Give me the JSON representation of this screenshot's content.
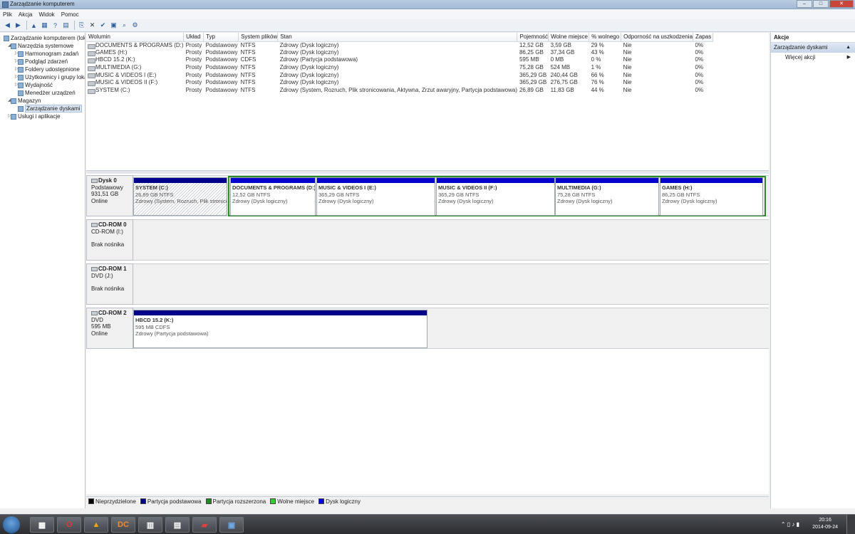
{
  "window": {
    "title": "Zarządzanie komputerem"
  },
  "menu": [
    "Plik",
    "Akcja",
    "Widok",
    "Pomoc"
  ],
  "tree": [
    {
      "label": "Zarządzanie komputerem (lokalne)",
      "level": 0,
      "twisty": ""
    },
    {
      "label": "Narzędzia systemowe",
      "level": 1,
      "twisty": "◢"
    },
    {
      "label": "Harmonogram zadań",
      "level": 2,
      "twisty": "▷"
    },
    {
      "label": "Podgląd zdarzeń",
      "level": 2,
      "twisty": "▷"
    },
    {
      "label": "Foldery udostępnione",
      "level": 2,
      "twisty": "▷"
    },
    {
      "label": "Użytkownicy i grupy lokalne",
      "level": 2,
      "twisty": "▷"
    },
    {
      "label": "Wydajność",
      "level": 2,
      "twisty": "▷"
    },
    {
      "label": "Menedżer urządzeń",
      "level": 2,
      "twisty": ""
    },
    {
      "label": "Magazyn",
      "level": 1,
      "twisty": "◢"
    },
    {
      "label": "Zarządzanie dyskami",
      "level": 2,
      "twisty": "",
      "selected": true
    },
    {
      "label": "Usługi i aplikacje",
      "level": 1,
      "twisty": "▷"
    }
  ],
  "volumes": {
    "columns": [
      "Wolumin",
      "Układ",
      "Typ",
      "System plików",
      "Stan",
      "Pojemność",
      "Wolne miejsce",
      "% wolnego",
      "Odporność na uszkodzenia",
      "Zapas"
    ],
    "rows": [
      [
        "DOCUMENTS & PROGRAMS (D:)",
        "Prosty",
        "Podstawowy",
        "NTFS",
        "Zdrowy (Dysk logiczny)",
        "12,52 GB",
        "3,59 GB",
        "29 %",
        "Nie",
        "0%"
      ],
      [
        "GAMES (H:)",
        "Prosty",
        "Podstawowy",
        "NTFS",
        "Zdrowy (Dysk logiczny)",
        "86,25 GB",
        "37,34 GB",
        "43 %",
        "Nie",
        "0%"
      ],
      [
        "HBCD 15.2 (K:)",
        "Prosty",
        "Podstawowy",
        "CDFS",
        "Zdrowy (Partycja podstawowa)",
        "595 MB",
        "0 MB",
        "0 %",
        "Nie",
        "0%"
      ],
      [
        "MULTIMEDIA (G:)",
        "Prosty",
        "Podstawowy",
        "NTFS",
        "Zdrowy (Dysk logiczny)",
        "75,28 GB",
        "524 MB",
        "1 %",
        "Nie",
        "0%"
      ],
      [
        "MUSIC & VIDEOS I (E:)",
        "Prosty",
        "Podstawowy",
        "NTFS",
        "Zdrowy (Dysk logiczny)",
        "365,29 GB",
        "240,44 GB",
        "66 %",
        "Nie",
        "0%"
      ],
      [
        "MUSIC & VIDEOS II (F:)",
        "Prosty",
        "Podstawowy",
        "NTFS",
        "Zdrowy (Dysk logiczny)",
        "365,29 GB",
        "276,75 GB",
        "76 %",
        "Nie",
        "0%"
      ],
      [
        "SYSTEM (C:)",
        "Prosty",
        "Podstawowy",
        "NTFS",
        "Zdrowy (System, Rozruch, Plik stronicowania, Aktywna, Zrzut awaryjny, Partycja podstawowa)",
        "26,89 GB",
        "11,83 GB",
        "44 %",
        "Nie",
        "0%"
      ]
    ]
  },
  "disks": [
    {
      "name": "Dysk 0",
      "line2": "Podstawowy",
      "line3": "931,51 GB",
      "line4": "Online",
      "partitions": [
        {
          "name": "SYSTEM (C:)",
          "size": "26,89 GB NTFS",
          "status": "Zdrowy (System, Rozruch, Plik stronicowania, Aktywna, Zrzut awaryjny, Partycja podstawowa)",
          "kind": "primary"
        },
        {
          "name": "DOCUMENTS & PROGRAMS (D:)",
          "size": "12,52 GB NTFS",
          "status": "Zdrowy (Dysk logiczny)",
          "kind": "logical"
        },
        {
          "name": "MUSIC & VIDEOS I (E:)",
          "size": "365,29 GB NTFS",
          "status": "Zdrowy (Dysk logiczny)",
          "kind": "logical"
        },
        {
          "name": "MUSIC & VIDEOS II (F:)",
          "size": "365,29 GB NTFS",
          "status": "Zdrowy (Dysk logiczny)",
          "kind": "logical"
        },
        {
          "name": "MULTIMEDIA (G:)",
          "size": "75,28 GB NTFS",
          "status": "Zdrowy (Dysk logiczny)",
          "kind": "logical"
        },
        {
          "name": "GAMES (H:)",
          "size": "86,25 GB NTFS",
          "status": "Zdrowy (Dysk logiczny)",
          "kind": "logical"
        }
      ]
    },
    {
      "name": "CD-ROM 0",
      "line2": "CD-ROM (I:)",
      "line3": "",
      "line4": "Brak nośnika",
      "partitions": []
    },
    {
      "name": "CD-ROM 1",
      "line2": "DVD (J:)",
      "line3": "",
      "line4": "Brak nośnika",
      "partitions": []
    },
    {
      "name": "CD-ROM 2",
      "line2": "DVD",
      "line3": "595 MB",
      "line4": "Online",
      "partitions": [
        {
          "name": "HBCD 15.2 (K:)",
          "size": "595 MB CDFS",
          "status": "Zdrowy (Partycja podstawowa)",
          "kind": "primary"
        }
      ]
    }
  ],
  "legend": [
    {
      "label": "Nieprzydzielone",
      "color": "#000000"
    },
    {
      "label": "Partycja podstawowa",
      "color": "#00008b"
    },
    {
      "label": "Partycja rozszerzona",
      "color": "#1e8c1e"
    },
    {
      "label": "Wolne miejsce",
      "color": "#32cd32"
    },
    {
      "label": "Dysk logiczny",
      "color": "#0000cd"
    }
  ],
  "actions": {
    "title": "Akcje",
    "group": "Zarządzanie dyskami",
    "more": "Więcej akcji"
  },
  "taskbar": {
    "apps": [
      "opera",
      "vlc",
      "dc",
      "calculator",
      "explorer",
      "toolbox",
      "network"
    ],
    "time": "20:16",
    "date": "2014-09-24"
  }
}
